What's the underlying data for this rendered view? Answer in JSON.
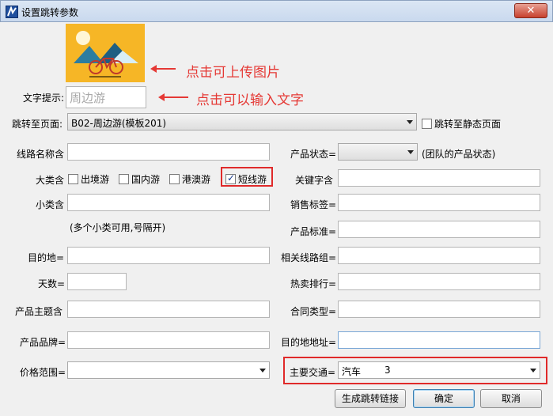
{
  "window": {
    "title": "设置跳转参数",
    "close_glyph": "✕"
  },
  "image_annotation": "点击可上传图片",
  "tip": {
    "label": "文字提示:",
    "placeholder": "周边游",
    "annotation": "点击可以输入文字"
  },
  "jump": {
    "label": "跳转至页面:",
    "selected": "B02-周边游(模板201)",
    "static_checkbox": "跳转至静态页面"
  },
  "left": {
    "route_name": "线路名称含",
    "category": {
      "label": "大类含",
      "options": [
        {
          "label": "出境游",
          "checked": false
        },
        {
          "label": "国内游",
          "checked": false
        },
        {
          "label": "港澳游",
          "checked": false
        },
        {
          "label": "短线游",
          "checked": true
        }
      ]
    },
    "subcategory": "小类含",
    "subcategory_hint": "(多个小类可用,号隔开)",
    "destination": "目的地=",
    "days": "天数=",
    "theme": "产品主题含",
    "brand": "产品品牌=",
    "price_range": "价格范围="
  },
  "right": {
    "status": "产品状态=",
    "status_hint": "(团队的产品状态)",
    "keyword": "关键字含",
    "sales_tag": "销售标签=",
    "standard": "产品标准=",
    "related_group": "相关线路组=",
    "hot_rank": "热卖排行=",
    "contract_type": "合同类型=",
    "dest_address": "目的地地址=",
    "transport": {
      "label": "主要交通=",
      "value": "汽车",
      "code": "3"
    }
  },
  "buttons": {
    "generate": "生成跳转链接",
    "ok": "确定",
    "cancel": "取消"
  },
  "colors": {
    "annotation_red": "#e53935",
    "highlight_box": "#e02a2a",
    "image_bg": "#f6b626"
  }
}
